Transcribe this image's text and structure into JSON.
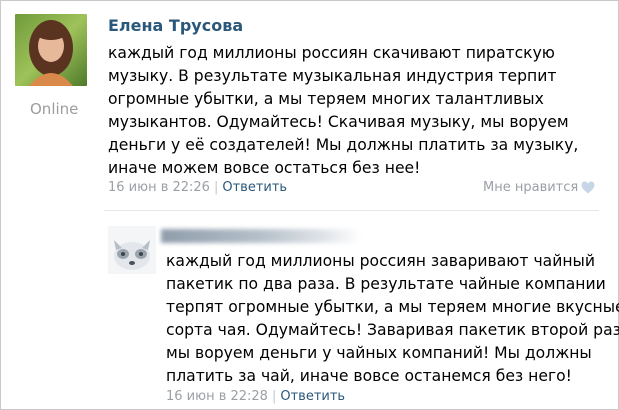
{
  "post": {
    "author": "Елена Трусова",
    "status": "Online",
    "text_lines": [
      "каждый год миллионы россиян скачивают пиратскую",
      "музыку. В результате музыкальная индустрия терпит",
      "огромные убытки, а мы теряем многих талантливых",
      "музыкантов. Одумайтесь! Скачивая музыку, мы воруем",
      "деньги у её создателей! Мы должны платить за музыку,",
      "иначе можем вовсе остаться без нее!"
    ],
    "date": "16 июн в 22:26",
    "separator": "|",
    "reply_label": "Ответить",
    "like_label": "Мне нравится",
    "like_icon": "heart-icon"
  },
  "reply": {
    "text_lines": [
      "каждый год миллионы россиян заваривают чайный",
      "пакетик по два раза. В результате чайные компании",
      "терпят огромные убытки, а мы теряем многие вкусные",
      "сорта чая. Одумайтесь! Заваривая пакетик второй раз,",
      "мы воруем деньги у чайных компаний! Мы должны",
      "платить за чай, иначе вовсе останемся без него!"
    ],
    "date": "16 июн в 22:28",
    "separator": "|",
    "reply_label": "Ответить"
  },
  "colors": {
    "link": "#2b587a",
    "meta": "#9aa0a6",
    "online": "#9d9d9d",
    "heart": "#c7d6e6"
  }
}
